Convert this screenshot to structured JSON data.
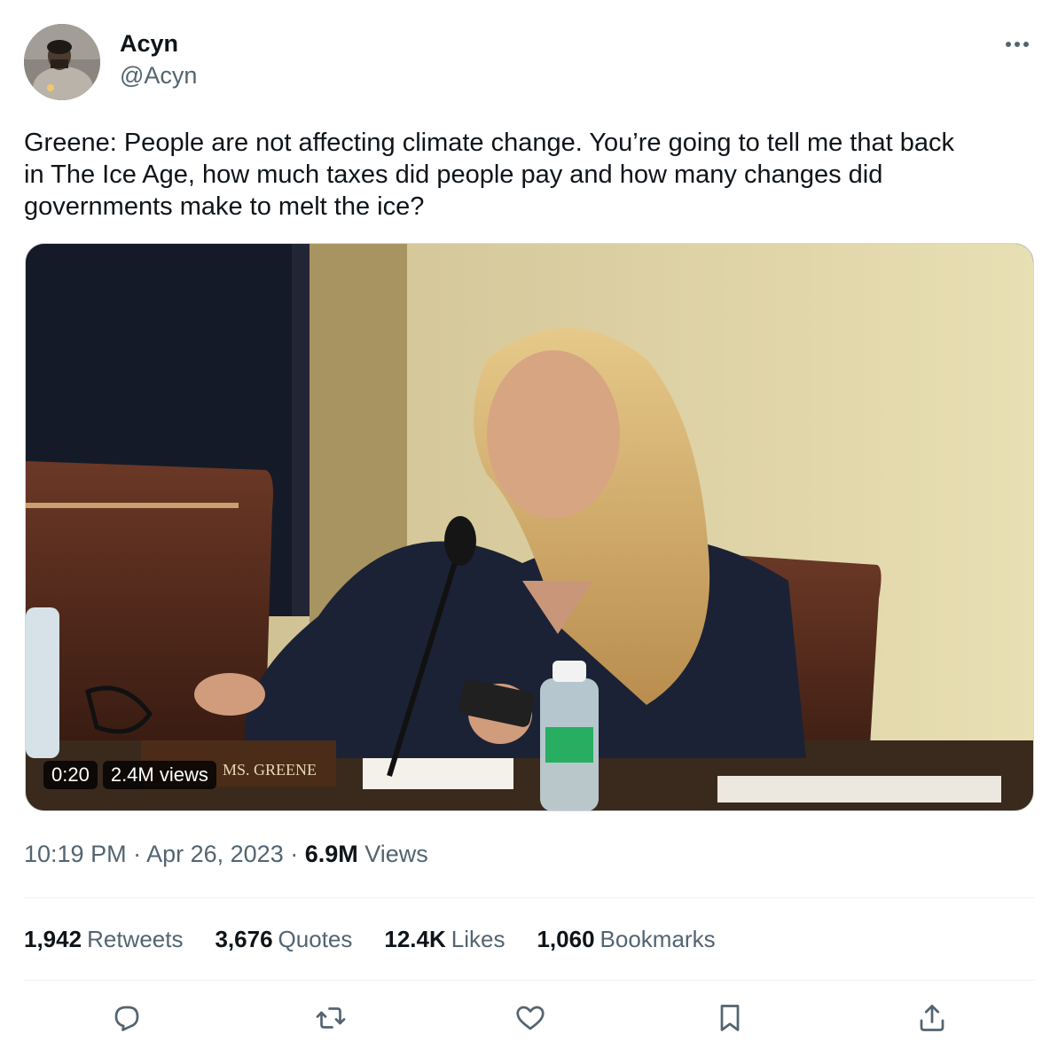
{
  "author": {
    "display_name": "Acyn",
    "handle": "@Acyn"
  },
  "icons": {
    "more": "more-horizontal-icon",
    "reply": "reply-icon",
    "retweet": "retweet-icon",
    "like": "heart-icon",
    "bookmark": "bookmark-icon",
    "share": "share-icon"
  },
  "tweet": {
    "text": "Greene: People are not affecting climate change. You’re going to tell me that back\nin The Ice Age, how much taxes did people pay and how many changes did\ngovernments make to melt the ice?"
  },
  "media": {
    "duration": "0:20",
    "views": "2.4M views",
    "nameplate": "MS. GREENE"
  },
  "meta": {
    "time": "10:19 PM",
    "sep1": " · ",
    "date": "Apr 26, 2023",
    "sep2": " · ",
    "views_count": "6.9M",
    "views_label": " Views"
  },
  "stats": [
    {
      "count": "1,942",
      "label": "Retweets"
    },
    {
      "count": "3,676",
      "label": "Quotes"
    },
    {
      "count": "12.4K",
      "label": "Likes"
    },
    {
      "count": "1,060",
      "label": "Bookmarks"
    }
  ],
  "colors": {
    "text_primary": "#0f1419",
    "text_secondary": "#536471",
    "divider": "#eff3f4",
    "icon": "#536471"
  }
}
